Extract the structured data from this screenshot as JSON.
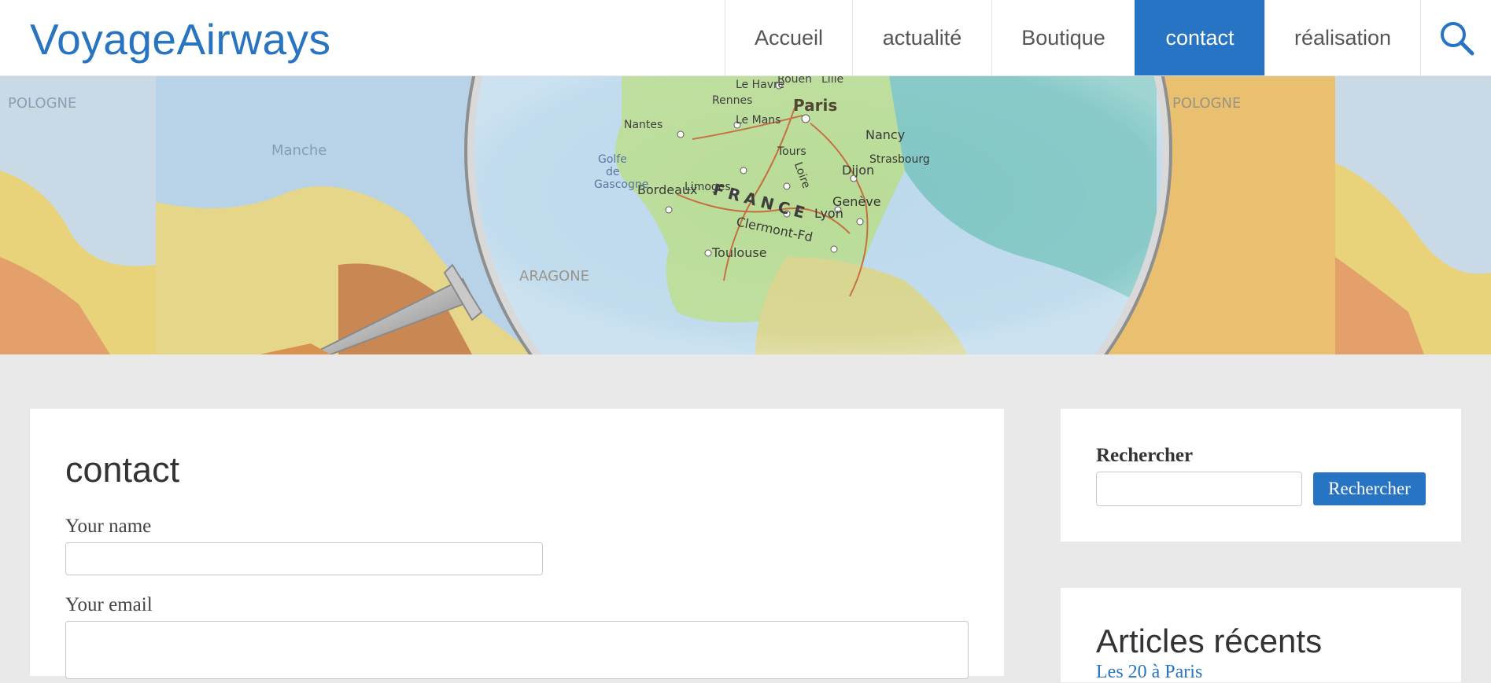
{
  "site": {
    "title": "VoyageAirways"
  },
  "nav": {
    "items": [
      {
        "label": "Accueil",
        "active": false
      },
      {
        "label": "actualité",
        "active": false
      },
      {
        "label": "Boutique",
        "active": false
      },
      {
        "label": "contact",
        "active": true
      },
      {
        "label": "réalisation",
        "active": false
      }
    ],
    "search_icon": "search-icon"
  },
  "hero": {
    "image": "map-of-france-under-magnifying-glass",
    "map_labels": [
      "Paris",
      "Le Havre",
      "Rouen",
      "Lille",
      "Rennes",
      "Le Mans",
      "Nantes",
      "Tours",
      "Loire",
      "FRANCE",
      "Limoges",
      "Bordeaux",
      "Clermont-Fd",
      "Lyon",
      "Dijon",
      "Nancy",
      "Strasbourg",
      "Genève",
      "Toulouse",
      "Golfe de Gascogne",
      "POLOGNE"
    ]
  },
  "content": {
    "page_title": "contact",
    "form": {
      "name_label": "Your name",
      "name_value": "",
      "email_label": "Your email",
      "email_value": ""
    }
  },
  "sidebar": {
    "search": {
      "heading": "Rechercher",
      "input_value": "",
      "button_label": "Rechercher"
    },
    "recent": {
      "heading": "Articles récents",
      "first_item": "Les 20 à Paris"
    }
  },
  "colors": {
    "accent": "#2773c4",
    "title": "#2874c0",
    "page_background": "#e9e9e9",
    "card_background": "#ffffff"
  }
}
